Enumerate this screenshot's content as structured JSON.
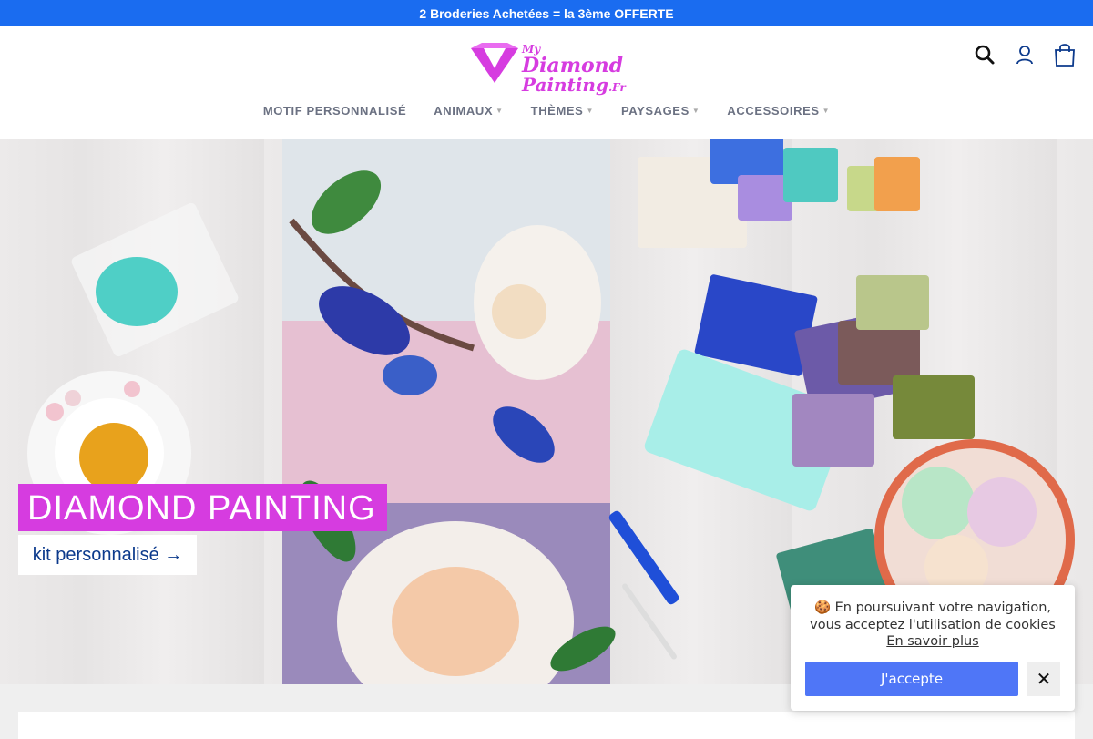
{
  "announcement": {
    "text": "2 Broderies Achetées = la 3ème OFFERTE"
  },
  "brand": {
    "my": "My",
    "line1": "Diamond",
    "line2": "Painting",
    "suffix": ".Fr",
    "color": "#d63ce0"
  },
  "header_icons": [
    "search-icon",
    "account-icon",
    "cart-icon"
  ],
  "nav": {
    "items": [
      {
        "label": "MOTIF PERSONNALISÉ",
        "has_dropdown": false
      },
      {
        "label": "ANIMAUX",
        "has_dropdown": true
      },
      {
        "label": "THÈMES",
        "has_dropdown": true
      },
      {
        "label": "PAYSAGES",
        "has_dropdown": true
      },
      {
        "label": "ACCESSOIRES",
        "has_dropdown": true
      }
    ]
  },
  "hero": {
    "title": "DIAMOND PAINTING",
    "subtitle": "kit personnalisé →"
  },
  "cookie": {
    "icon": "cookie-icon",
    "message": "En poursuivant votre navigation, vous acceptez l'utilisation de cookies",
    "link": "En savoir plus",
    "accept": "J'accepte",
    "close": "✕"
  },
  "colors": {
    "announcement_bg": "#1a6cf0",
    "accent": "#d63ce0",
    "button": "#4f76f7",
    "nav_text": "#6b7182"
  }
}
